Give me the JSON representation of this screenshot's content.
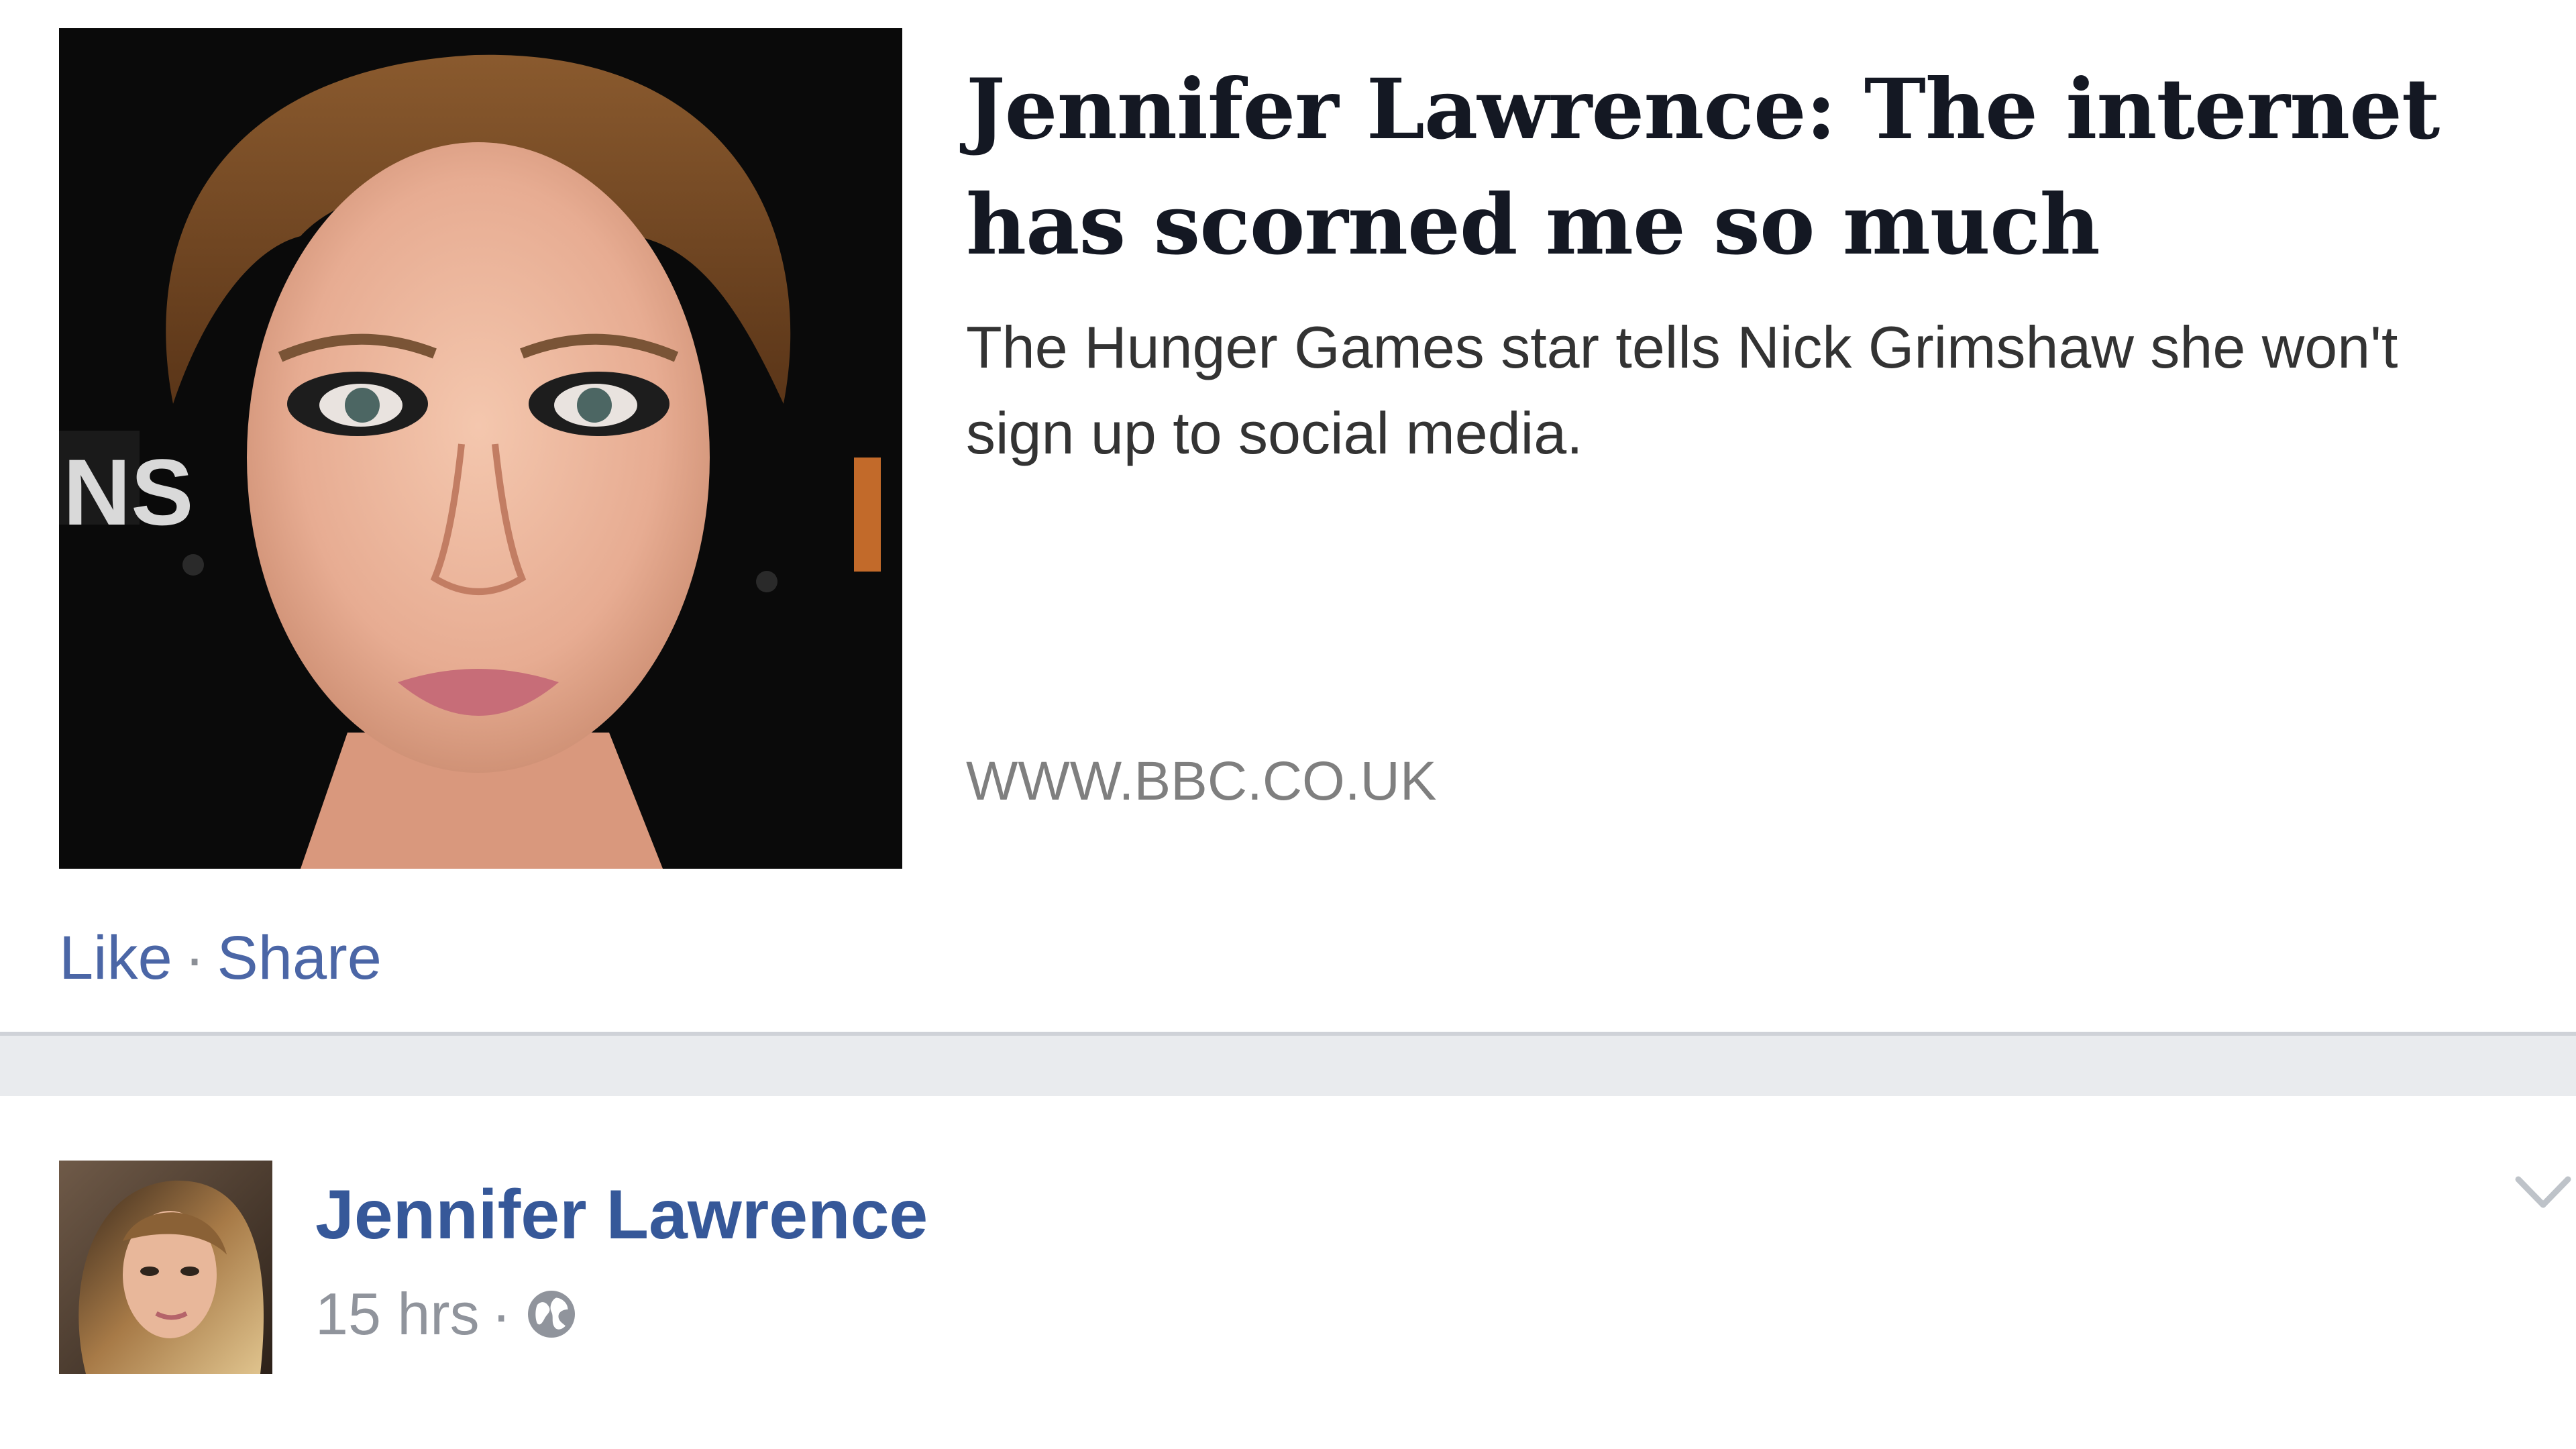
{
  "link_preview": {
    "title": "Jennifer Lawrence: The internet has scorned me so much",
    "description": "The Hunger Games star tells Nick Grimshaw she won't sign up to social media.",
    "domain": "WWW.BBC.CO.UK",
    "image_icon": "portrait-photo"
  },
  "actions": {
    "like_label": "Like",
    "separator": "·",
    "share_label": "Share"
  },
  "next_post": {
    "author_name": "Jennifer Lawrence",
    "timestamp": "15 hrs",
    "separator": "·",
    "privacy_icon": "globe-icon",
    "menu_icon": "chevron-down-icon"
  },
  "colors": {
    "link_blue": "#4b66a6",
    "author_blue": "#365899",
    "meta_gray": "#90949c",
    "feed_background": "#e9ebee"
  }
}
